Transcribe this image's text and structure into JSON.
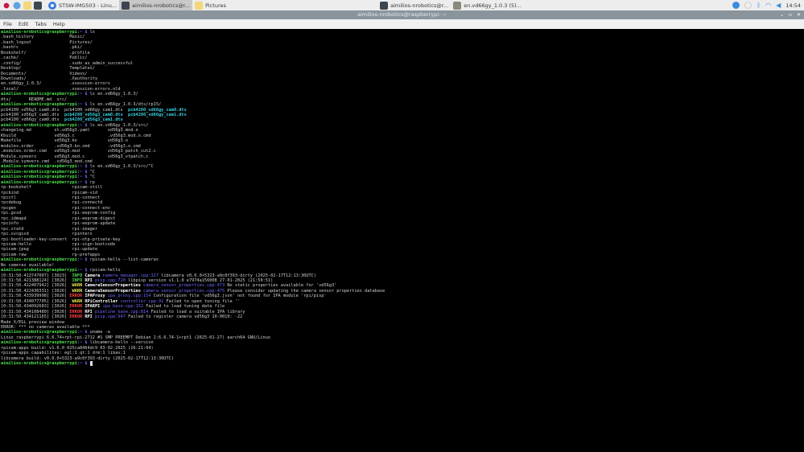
{
  "taskbar": {
    "windows": [
      "STSW-IMG503 - Linu...",
      "aimilios-nrobotics@r...",
      "Pictures",
      "aimilios-nrobotics@r...",
      "en.vd66gy_1.0.3 (5)..."
    ],
    "clock": "14:54"
  },
  "window": {
    "title": "aimilios-nrobotics@raspberrypi: ~"
  },
  "menu": [
    "File",
    "Edit",
    "Tabs",
    "Help"
  ],
  "prompt": {
    "user": "aimilios-nrobotics@raspberrypi",
    "path": ":~ ",
    "sign": "$ "
  },
  "terminal": [
    [
      [
        "P",
        ""
      ],
      [
        "",
        "ls"
      ]
    ],
    [
      [
        "",
        ".bash_history              Music/"
      ]
    ],
    [
      [
        "",
        ".bash_logout               Pictures/"
      ]
    ],
    [
      [
        "",
        ".bashrc                    .pki/"
      ]
    ],
    [
      [
        "",
        "Bookshelf/                 .profile"
      ]
    ],
    [
      [
        "",
        ".cache/                    Public/"
      ]
    ],
    [
      [
        "",
        ".config/                   .sudo_as_admin_successful"
      ]
    ],
    [
      [
        "",
        "Desktop/                   Templates/"
      ]
    ],
    [
      [
        "",
        "Documents/                 Videos/"
      ]
    ],
    [
      [
        "",
        "Downloads/                 .Xauthority"
      ]
    ],
    [
      [
        "",
        "en.vd66gy_1.0.3/           .xsession-errors"
      ]
    ],
    [
      [
        "",
        ".local/                    .xsession-errors.old"
      ]
    ],
    [
      [
        "P",
        ""
      ],
      [
        "",
        "ls en.vd66gy_1.0.3/"
      ]
    ],
    [
      [
        "",
        "dts/       README.md  src/"
      ]
    ],
    [
      [
        "P",
        ""
      ],
      [
        "",
        "ls en.vd66gy_1.0.3/dts/rp15/"
      ]
    ],
    [
      [
        "",
        "pcb4100_vd56g3_cam0.dts  pcb4100_vd66gy_cam1.dts  "
      ],
      [
        "cy",
        "pcb4280_vd66gy_cam0.dts"
      ]
    ],
    [
      [
        "",
        "pcb4100_vd56g3_cam1.dts  "
      ],
      [
        "cy",
        "pcb4280_vd56g3_cam0.dts  pcb4280_vd66gy_cam1.dts"
      ]
    ],
    [
      [
        "",
        "pcb4100_vd66gy_cam0.dts  "
      ],
      [
        "cy",
        "pcb4280_vd56g3_cam1.dts"
      ]
    ],
    [
      [
        "P",
        ""
      ],
      [
        "",
        "ls en.vd66gy_1.0.3/src/"
      ]
    ],
    [
      [
        "",
        "changelog.md         st,vd56g3.yaml       vd56g3.mod.o"
      ]
    ],
    [
      [
        "",
        "Kbuild               vd56g3.c             .vd56g3.mod.o.cmd"
      ]
    ],
    [
      [
        "",
        "Makefile             vd56g3.ko            vd56g3.o"
      ]
    ],
    [
      [
        "",
        "modules.order        .vd56g3.ko.cmd       .vd56g3.o.cmd"
      ]
    ],
    [
      [
        "",
        ".modules.order.cmd   vd56g3.mod           vd56g3_patch_cut2.c"
      ]
    ],
    [
      [
        "",
        "Module.symvers       vd56g3.mod.c         vd56g3_vtpatch.c"
      ]
    ],
    [
      [
        "",
        ".Module.symvers.cmd  .vd56g3.mod.cmd"
      ]
    ],
    [
      [
        "P",
        ""
      ],
      [
        "",
        "ls en.vd66gy_1.0.3/src/^C"
      ]
    ],
    [
      [
        "P",
        ""
      ],
      [
        "",
        "^C"
      ]
    ],
    [
      [
        "P",
        ""
      ],
      [
        "",
        "^C"
      ]
    ],
    [
      [
        "P",
        ""
      ],
      [
        "",
        "rp"
      ]
    ],
    [
      [
        "",
        "rp-bookshelf                rpicam-still"
      ]
    ],
    [
      [
        "",
        "rpcbind                     rpicam-vid"
      ]
    ],
    [
      [
        "",
        "rpcctl                      rpi-connect"
      ]
    ],
    [
      [
        "",
        "rpcdebug                    rpi-connectd"
      ]
    ],
    [
      [
        "",
        "rpcgen                      rpi-connect-env"
      ]
    ],
    [
      [
        "",
        "rpc.gssd                    rpi-eeprom-config"
      ]
    ],
    [
      [
        "",
        "rpc.idmapd                  rpi-eeprom-digest"
      ]
    ],
    [
      [
        "",
        "rpcinfo                     rpi-eeprom-update"
      ]
    ],
    [
      [
        "",
        "rpc.statd                   rpi-imager"
      ]
    ],
    [
      [
        "",
        "rpc.svcgssd                 rpinters"
      ]
    ],
    [
      [
        "",
        "rpi-bootloader-key-convert  rpi-otp-private-key"
      ]
    ],
    [
      [
        "",
        "rpicam-hello                rpi-sign-bootcode"
      ]
    ],
    [
      [
        "",
        "rpicam-jpeg                 rpi-update"
      ]
    ],
    [
      [
        "",
        "rpicam-raw                  rp-prefapps"
      ]
    ],
    [
      [
        "P",
        ""
      ],
      [
        "",
        "rpicam-hello --list-cameras"
      ]
    ],
    [
      [
        "",
        "No cameras available!"
      ]
    ],
    [
      [
        "P",
        ""
      ],
      [
        "",
        "rpicam-hello"
      ]
    ],
    [
      [
        "",
        "[0:31:50.413747007] [3023]  "
      ],
      [
        "info",
        "INFO"
      ],
      [
        "bd",
        " Camera "
      ],
      [
        "lk",
        "camera_manager.cpp:327"
      ],
      [
        "",
        " libcamera v0.0.0+5323-a9c0f393-dirty (2025-02-17T12:13:30UTC)"
      ]
    ],
    [
      [
        "",
        "[0:31:50.421388124] [3026]  "
      ],
      [
        "info",
        "INFO"
      ],
      [
        "bd",
        " RPI "
      ],
      [
        "lk",
        "pisp.cpp:720"
      ],
      [
        "",
        " libpisp version v1.1.0 e7974a156008 27-01-2025 (21:50:51)"
      ]
    ],
    [
      [
        "",
        "[0:31:50.422407942] [3026]  "
      ],
      [
        "warn",
        "WARN"
      ],
      [
        "bd",
        " CameraSensorProperties "
      ],
      [
        "lk",
        "camera_sensor_properties.cpp:473"
      ],
      [
        "",
        " No static properties available for 'vd56g3'"
      ]
    ],
    [
      [
        "",
        "[0:31:50.422430331] [3026]  "
      ],
      [
        "warn",
        "WARN"
      ],
      [
        "bd",
        " CameraSensorProperties "
      ],
      [
        "lk",
        "camera_sensor_properties.cpp:475"
      ],
      [
        "",
        " Please consider updating the camera sensor properties database"
      ]
    ],
    [
      [
        "",
        "[0:31:50.433939998] [3026] "
      ],
      [
        "err",
        "ERROR"
      ],
      [
        "bd",
        " IPAProxy "
      ],
      [
        "lk",
        "ipa_proxy.cpp:154"
      ],
      [
        "",
        " Configuration file 'vd56g3.json' not found for IPA module 'rpi/pisp'"
      ]
    ],
    [
      [
        "",
        "[0:31:50.434077705] [3026]  "
      ],
      [
        "warn",
        "WARN"
      ],
      [
        "bd",
        " RPiController "
      ],
      [
        "lk",
        "controller.cpp:91"
      ],
      [
        "",
        " Failed to open tuning file ''"
      ]
    ],
    [
      [
        "",
        "[0:31:50.434092683] [3026] "
      ],
      [
        "err",
        "ERROR"
      ],
      [
        "bd",
        " IPARPI "
      ],
      [
        "lk",
        "ipa_base.cpp:152"
      ],
      [
        "",
        " Failed to load tuning data file"
      ]
    ],
    [
      [
        "",
        "[0:31:50.434108480] [3026] "
      ],
      [
        "err",
        "ERROR"
      ],
      [
        "bd",
        " RPI "
      ],
      [
        "lk",
        "pipeline_base.cpp:814"
      ],
      [
        "",
        " Failed to load a suitable IPA library"
      ]
    ],
    [
      [
        "",
        "[0:31:50.434121165] [3026] "
      ],
      [
        "err",
        "ERROR"
      ],
      [
        "bd",
        " RPI "
      ],
      [
        "lk",
        "pisp.cpp:947"
      ],
      [
        "",
        " Failed to register camera vd56g3 10-0010: -22"
      ]
    ],
    [
      [
        "",
        "Made X/EGL preview window"
      ]
    ],
    [
      [
        "",
        "ERROR: *** no cameras available ***"
      ]
    ],
    [
      [
        "P",
        ""
      ],
      [
        "",
        "uname -a"
      ]
    ],
    [
      [
        "",
        "Linux raspberrypi 6.6.74+rpt-rpi-2712 #1 SMP PREEMPT Debian 1:6.6.74-1+rpt1 (2025-01-27) aarch64 GNU/Linux"
      ]
    ],
    [
      [
        "P",
        ""
      ],
      [
        "",
        "libcamera-hello --version"
      ]
    ],
    [
      [
        "",
        "rpicam-apps build: v1.6.0 025ca8464dc9 03-02-2025 (16:21:04)"
      ]
    ],
    [
      [
        "",
        "rpicam-apps capabilites: egl:1 qt:1 drm:1 libav:1"
      ]
    ],
    [
      [
        "",
        "libcamera build: v0.0.0+5323-a9c0f393-dirty (2025-02-17T12:13:30UTC)"
      ]
    ],
    [
      [
        "P",
        ""
      ],
      [
        "C",
        " "
      ]
    ]
  ]
}
